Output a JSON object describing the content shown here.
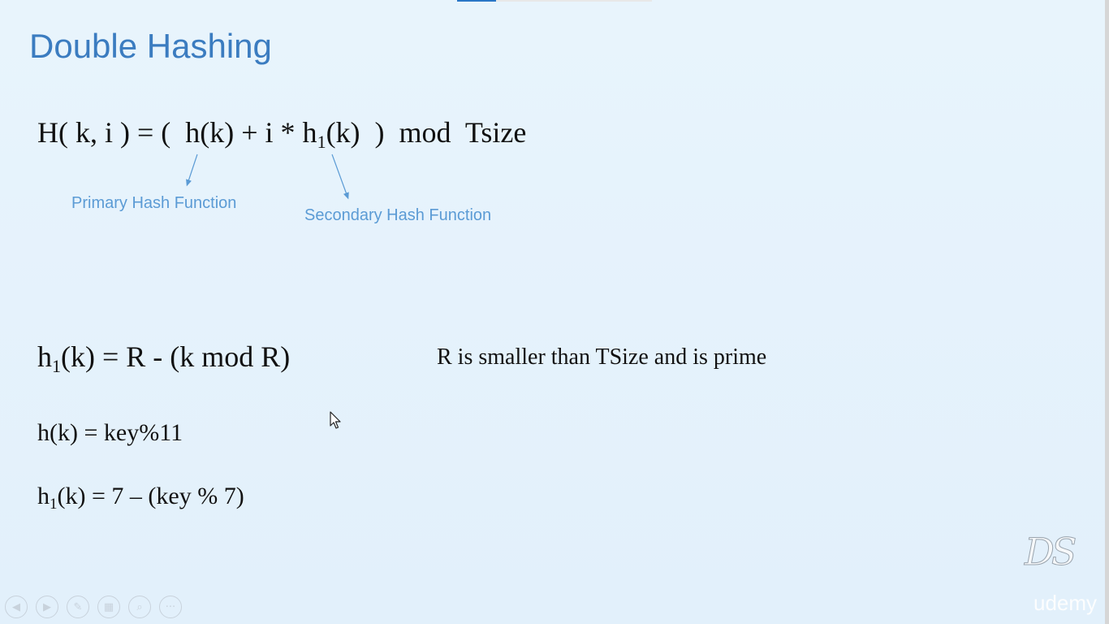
{
  "slide": {
    "title": "Double Hashing",
    "main_equation": {
      "prefix": "H( k, i ) = (  h(k) + i * h",
      "sub": "1",
      "suffix": "(k)  )  mod  Tsize"
    },
    "annotations": {
      "primary": "Primary Hash Function",
      "secondary": "Secondary Hash Function"
    },
    "secondary_equation": {
      "prefix": "h",
      "sub": "1",
      "suffix": "(k) = R - (k mod R)"
    },
    "note": "R is smaller than TSize and is prime",
    "hk_equation": "h(k) = key%11",
    "h1k_equation": {
      "prefix": "h",
      "sub": "1",
      "suffix": "(k) = 7 – (key % 7)"
    }
  },
  "branding": {
    "logo": "DS",
    "watermark": "udemy"
  },
  "controls": [
    {
      "icon": "previous-icon",
      "glyph": "◀"
    },
    {
      "icon": "next-icon",
      "glyph": "▶"
    },
    {
      "icon": "pen-icon",
      "glyph": "✎"
    },
    {
      "icon": "slides-icon",
      "glyph": "▦"
    },
    {
      "icon": "zoom-icon",
      "glyph": "⌕"
    },
    {
      "icon": "more-icon",
      "glyph": "···"
    }
  ],
  "colors": {
    "title": "#3b7cc0",
    "annotation": "#5b9bd5",
    "accent": "#2a76c6"
  }
}
